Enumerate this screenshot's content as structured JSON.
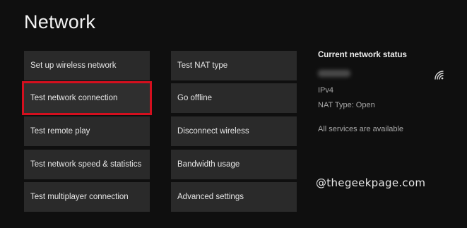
{
  "page": {
    "title": "Network"
  },
  "menu": {
    "left_column": [
      {
        "label": "Set up wireless network"
      },
      {
        "label": "Test network connection",
        "selected": true
      },
      {
        "label": "Test remote play"
      },
      {
        "label": "Test network speed & statistics"
      },
      {
        "label": "Test multiplayer connection"
      }
    ],
    "right_column": [
      {
        "label": "Test NAT type"
      },
      {
        "label": "Go offline"
      },
      {
        "label": "Disconnect wireless"
      },
      {
        "label": "Bandwidth usage"
      },
      {
        "label": "Advanced settings"
      }
    ]
  },
  "status": {
    "title": "Current network status",
    "ip_version": "IPv4",
    "nat_type": "NAT Type: Open",
    "services": "All services are available",
    "icon": "wifi-icon"
  },
  "watermark": {
    "text": "@thegeekpage.com"
  },
  "colors": {
    "background": "#0f0f0f",
    "tile": "#2a2a2a",
    "selection_outline": "#d40f1e"
  }
}
